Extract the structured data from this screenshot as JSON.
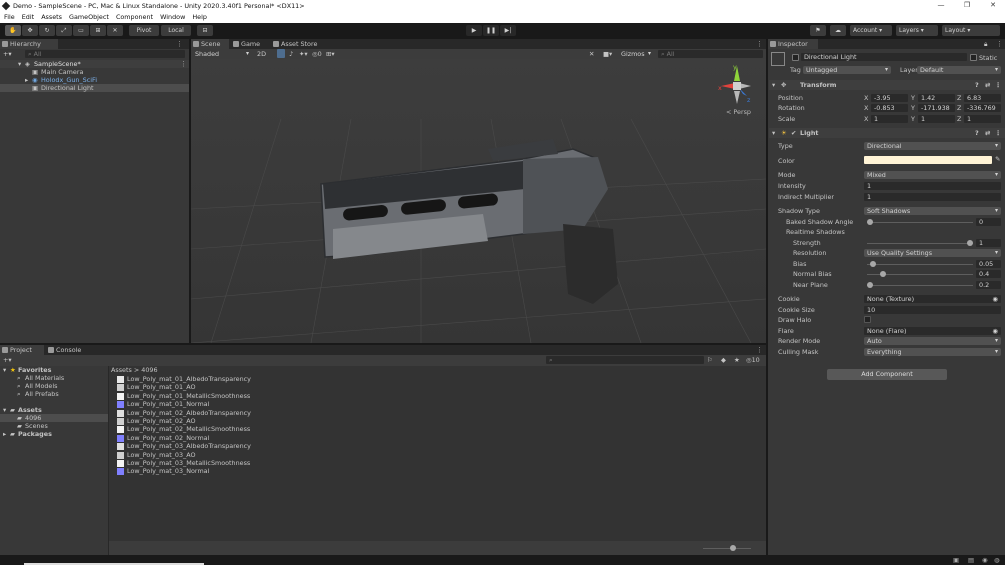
{
  "window": {
    "title": "Demo - SampleScene - PC, Mac & Linux Standalone - Unity 2020.3.40f1 Personal* <DX11>",
    "minimize": "—",
    "maximize": "❐",
    "close": "✕"
  },
  "menu": [
    "File",
    "Edit",
    "Assets",
    "GameObject",
    "Component",
    "Window",
    "Help"
  ],
  "toolbar": {
    "pivot": "Pivot",
    "local": "Local",
    "account": "Account",
    "layers": "Layers",
    "layout": "Layout"
  },
  "hierarchy": {
    "tab": "Hierarchy",
    "search_placeholder": "All",
    "scene": "SampleScene*",
    "items": [
      "Main Camera",
      "Holodx_Gun_SciFi",
      "Directional Light"
    ]
  },
  "scene_view": {
    "tabs": [
      "Scene",
      "Game",
      "Asset Store"
    ],
    "shading": "Shaded",
    "mode_2d": "2D",
    "gizmos": "Gizmos",
    "search_placeholder": "All",
    "persp": "< Persp",
    "axis_x": "x",
    "axis_y": "y",
    "axis_z": "z",
    "fx_count": "0"
  },
  "project": {
    "tabs": [
      "Project",
      "Console"
    ],
    "favorites_label": "Favorites",
    "favorites": [
      "All Materials",
      "All Models",
      "All Prefabs"
    ],
    "assets_label": "Assets",
    "asset_folders": [
      "4096",
      "Scenes"
    ],
    "packages_label": "Packages",
    "breadcrumb_root": "Assets",
    "breadcrumb_sep": ">",
    "breadcrumb_current": "4096",
    "hidden_count": "10",
    "files": [
      {
        "name": "Low_Poly_mat_01_AlbedoTransparency",
        "thumb": "#e8e8e8"
      },
      {
        "name": "Low_Poly_mat_01_AO",
        "thumb": "#d0d0d0"
      },
      {
        "name": "Low_Poly_mat_01_MetallicSmoothness",
        "thumb": "#f4f4f4"
      },
      {
        "name": "Low_Poly_mat_01_Normal",
        "thumb": "#8080ff"
      },
      {
        "name": "Low_Poly_mat_02_AlbedoTransparency",
        "thumb": "#e0e0e0"
      },
      {
        "name": "Low_Poly_mat_02_AO",
        "thumb": "#d0d0d0"
      },
      {
        "name": "Low_Poly_mat_02_MetallicSmoothness",
        "thumb": "#f4f4f4"
      },
      {
        "name": "Low_Poly_mat_02_Normal",
        "thumb": "#8080ff"
      },
      {
        "name": "Low_Poly_mat_03_AlbedoTransparency",
        "thumb": "#e0e0e0"
      },
      {
        "name": "Low_Poly_mat_03_AO",
        "thumb": "#d0d0d0"
      },
      {
        "name": "Low_Poly_mat_03_MetallicSmoothness",
        "thumb": "#f4f4f4"
      },
      {
        "name": "Low_Poly_mat_03_Normal",
        "thumb": "#8080ff"
      }
    ]
  },
  "inspector": {
    "tab": "Inspector",
    "object_name": "Directional Light",
    "static_label": "Static",
    "tag_label": "Tag",
    "tag_value": "Untagged",
    "layer_label": "Layer",
    "layer_value": "Default",
    "transform": {
      "title": "Transform",
      "position_label": "Position",
      "rotation_label": "Rotation",
      "scale_label": "Scale",
      "x": "X",
      "y": "Y",
      "z": "Z",
      "position": [
        "-3.95",
        "1.42",
        "6.83"
      ],
      "rotation": [
        "-0.853",
        "-171.938",
        "-336.769"
      ],
      "scale": [
        "1",
        "1",
        "1"
      ]
    },
    "light": {
      "title": "Light",
      "type_label": "Type",
      "type": "Directional",
      "color_label": "Color",
      "color": "#fff4d6",
      "mode_label": "Mode",
      "mode": "Mixed",
      "intensity_label": "Intensity",
      "intensity": "1",
      "indirect_label": "Indirect Multiplier",
      "indirect": "1",
      "shadow_type_label": "Shadow Type",
      "shadow_type": "Soft Shadows",
      "baked_angle_label": "Baked Shadow Angle",
      "baked_angle": "0",
      "baked_angle_level": 0,
      "realtime_label": "Realtime Shadows",
      "strength_label": "Strength",
      "strength": "1",
      "strength_level": 1,
      "resolution_label": "Resolution",
      "resolution": "Use Quality Settings",
      "bias_label": "Bias",
      "bias": "0.05",
      "bias_level": 0.025,
      "normal_bias_label": "Normal Bias",
      "normal_bias": "0.4",
      "normal_bias_level": 0.13,
      "near_plane_label": "Near Plane",
      "near_plane": "0.2",
      "near_plane_level": 0,
      "cookie_label": "Cookie",
      "cookie": "None (Texture)",
      "cookie_size_label": "Cookie Size",
      "cookie_size": "10",
      "draw_halo_label": "Draw Halo",
      "flare_label": "Flare",
      "flare": "None (Flare)",
      "render_mode_label": "Render Mode",
      "render_mode": "Auto",
      "culling_label": "Culling Mask",
      "culling": "Everything"
    },
    "add_component": "Add Component"
  },
  "colors": {
    "panel": "#383838",
    "scene": "#3a3a3a",
    "selection": "#4d4d4d",
    "accent": "#3a79bb"
  },
  "scene_slider_level": 0.65
}
